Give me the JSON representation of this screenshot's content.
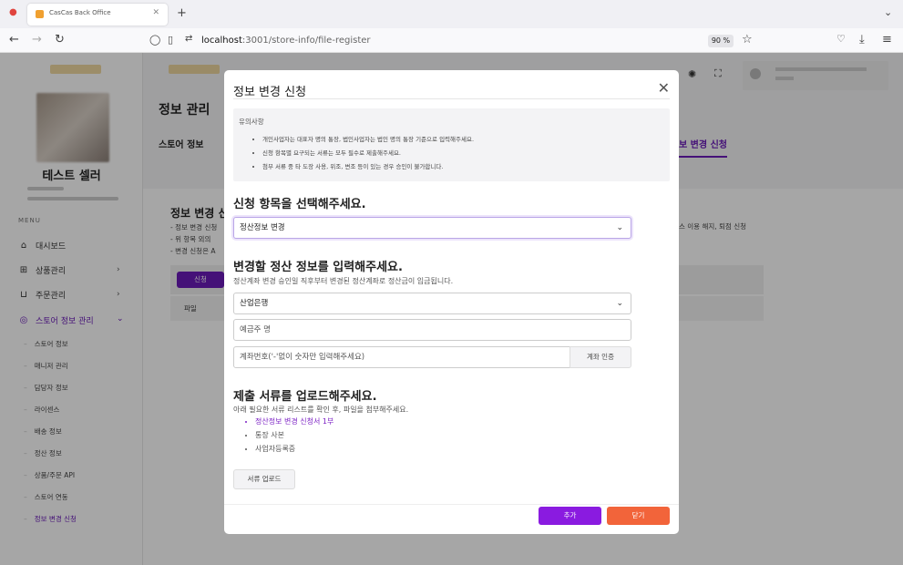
{
  "browser": {
    "tab_title": "CasCas Back Office",
    "url_host": "localhost",
    "url_path": ":3001/store-info/file-register",
    "zoom": "90 %"
  },
  "sidebar": {
    "seller_name": "테스트 셀러",
    "menu_header": "MENU",
    "items": [
      {
        "label": "대시보드"
      },
      {
        "label": "상품관리"
      },
      {
        "label": "주문관리"
      },
      {
        "label": "스토어 정보 관리"
      }
    ],
    "sub_items": [
      {
        "label": "스토어 정보"
      },
      {
        "label": "매니저 관리"
      },
      {
        "label": "담당자 정보"
      },
      {
        "label": "라이센스"
      },
      {
        "label": "배송 정보"
      },
      {
        "label": "정산 정보"
      },
      {
        "label": "상품/주문 API"
      },
      {
        "label": "스토어 연동"
      },
      {
        "label": "정보 변경 신청"
      }
    ]
  },
  "page": {
    "title": "정보 관리",
    "sub_tab": "스토어 정보",
    "right_tab": "보 변경 신청",
    "card_title": "정보 변경 신",
    "card_lines": [
      "- 정보 변경 신청",
      "- 위 항목 외의 ",
      "- 변경 신청은 A"
    ],
    "right_line": "스 이용 해지, 퇴점 신청",
    "apply_button": "신청",
    "file_label": "파일"
  },
  "modal": {
    "title": "정보 변경 신청",
    "notice": {
      "heading": "유의사항",
      "items": [
        "개인사업자는 대표자 명의 통장, 법인사업자는 법인 명의 통장 기준으로 입력해주세요.",
        "신청 항목별 요구되는 서류는 모두 필수로 제출해주세요.",
        "첨부 서류 중 타 도장 사용, 위조, 변조 등이 있는 경우 승인이 불가합니다."
      ]
    },
    "section1": {
      "heading": "신청 항목을 선택해주세요.",
      "selected": "정산정보 변경"
    },
    "section2": {
      "heading": "변경할 정산 정보를 입력해주세요.",
      "subtext": "정산계좌 변경 승인일 직후부터 변경된 정산계좌로 정산금이 입금됩니다.",
      "bank_selected": "산업은행",
      "holder_placeholder": "예금주 명",
      "account_placeholder": "계좌번호('-'없이 숫자만 입력해주세요)",
      "verify_button": "계좌 인증"
    },
    "section3": {
      "heading": "제출 서류를 업로드해주세요.",
      "subtext": "아래 필요한 서류 리스트를 확인 후, 파일을 첨부해주세요.",
      "docs": [
        "정산정보 변경 신청서 1부",
        "통장 사본",
        "사업자등록증"
      ],
      "upload_button": "서류 업로드"
    },
    "add_button": "추가",
    "close_button": "닫기"
  },
  "colors": {
    "accent": "#6a1bb8",
    "add_button": "#8a1be0",
    "close_button": "#f2643a"
  }
}
